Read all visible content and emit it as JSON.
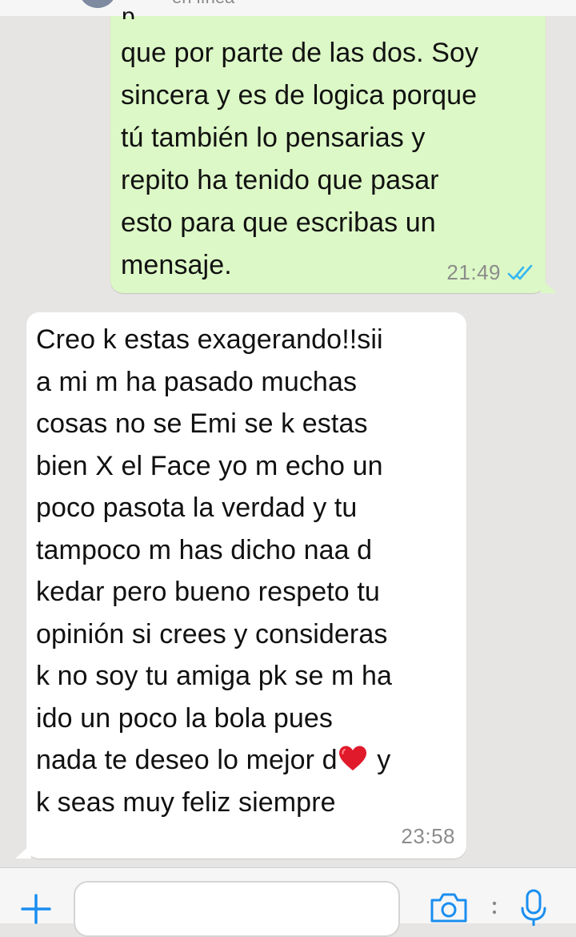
{
  "header": {
    "status": "en línea"
  },
  "messages": [
    {
      "direction": "outgoing",
      "text": "que por parte de las dos. Soy\nsincera y es de logica porque\ntú también lo pensarias y\nrepito ha tenido que pasar\nesto para que escribas un\nmensaje.",
      "time": "21:49",
      "status": "read",
      "tick_color": "#34b7f1"
    },
    {
      "direction": "incoming",
      "text_before_emoji": "Creo k estas exagerando!!sii\na mi m ha pasado muchas\ncosas no se Emi se k estas\nbien X el Face yo m echo un\npoco pasota la verdad y tu\ntampoco m has dicho naa d\nkedar pero bueno respeto tu\nopinión si crees y consideras\nk no soy tu amiga pk se m ha\nido un poco la bola pues\nnada te deseo lo mejor d",
      "emoji": "red-heart",
      "text_after_emoji": " y\nk seas muy feliz siempre",
      "time": "23:58"
    }
  ],
  "input_bar": {
    "placeholder": "",
    "icons": [
      "plus-icon",
      "camera-icon",
      "microphone-icon"
    ],
    "accent": "#1a8ef0"
  },
  "colors": {
    "outgoing_bubble": "#dcf8c6",
    "incoming_bubble": "#ffffff",
    "background": "#e6e5e3"
  }
}
